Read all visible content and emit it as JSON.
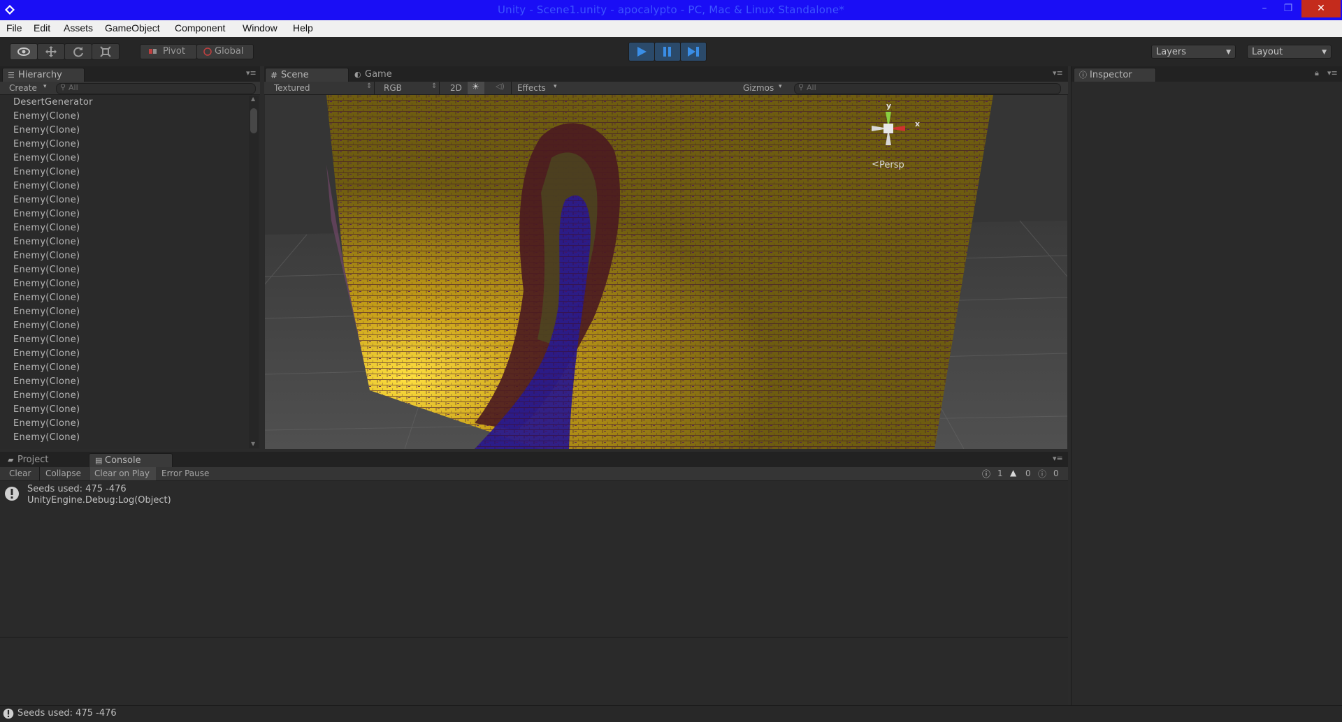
{
  "window": {
    "title": "Unity - Scene1.unity - apocalypto - PC, Mac & Linux Standalone*",
    "minimize": "–",
    "maximize": "❐",
    "close": "✕"
  },
  "menu": [
    "File",
    "Edit",
    "Assets",
    "GameObject",
    "Component",
    "Window",
    "Help"
  ],
  "toolbar": {
    "pivot_label": "Pivot",
    "global_label": "Global",
    "layers_label": "Layers",
    "layout_label": "Layout"
  },
  "hierarchy": {
    "tab_label": "Hierarchy",
    "create_label": "Create",
    "search_placeholder": "All",
    "items": [
      "DesertGenerator",
      "Enemy(Clone)",
      "Enemy(Clone)",
      "Enemy(Clone)",
      "Enemy(Clone)",
      "Enemy(Clone)",
      "Enemy(Clone)",
      "Enemy(Clone)",
      "Enemy(Clone)",
      "Enemy(Clone)",
      "Enemy(Clone)",
      "Enemy(Clone)",
      "Enemy(Clone)",
      "Enemy(Clone)",
      "Enemy(Clone)",
      "Enemy(Clone)",
      "Enemy(Clone)",
      "Enemy(Clone)",
      "Enemy(Clone)",
      "Enemy(Clone)",
      "Enemy(Clone)",
      "Enemy(Clone)",
      "Enemy(Clone)",
      "Enemy(Clone)",
      "Enemy(Clone)"
    ]
  },
  "scene": {
    "tab_scene": "Scene",
    "tab_game": "Game",
    "draw_mode": "Textured",
    "render_mode": "RGB",
    "mode_2d": "2D",
    "effects_label": "Effects",
    "gizmos_label": "Gizmos",
    "search_placeholder": "All",
    "gizmo_y": "y",
    "gizmo_x": "x",
    "persp_label": "Persp"
  },
  "inspector": {
    "tab_label": "Inspector"
  },
  "console": {
    "tab_project": "Project",
    "tab_console": "Console",
    "btn_clear": "Clear",
    "btn_collapse": "Collapse",
    "btn_clear_on_play": "Clear on Play",
    "btn_error_pause": "Error Pause",
    "count_info": "1",
    "count_warn": "0",
    "count_error": "0",
    "entries": [
      {
        "line1": "Seeds used: 475 -476",
        "line2": "UnityEngine.Debug:Log(Object)"
      }
    ]
  },
  "status": {
    "message": "Seeds used: 475 -476"
  },
  "colors": {
    "titlebar": "#1a0ef5",
    "play_blue": "#3a8ee6",
    "terrain_yellow": "#a58a10",
    "terrain_dark_red": "#4a1a20",
    "terrain_blue": "#2a1a8c"
  }
}
